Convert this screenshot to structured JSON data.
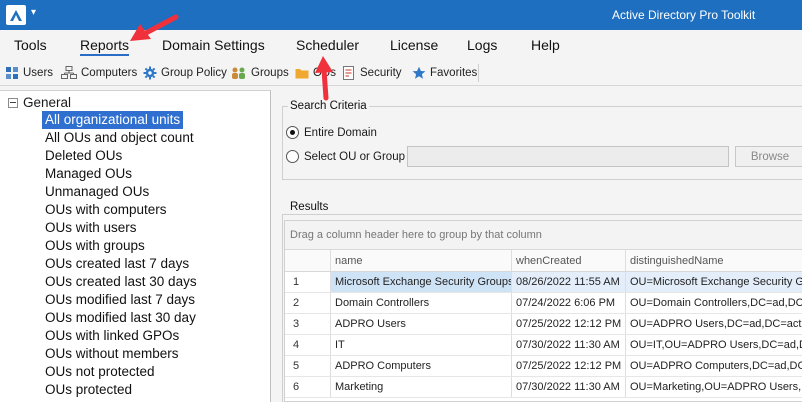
{
  "window": {
    "title": "Active Directory Pro Toolkit",
    "qa_dropdown": "▾"
  },
  "menu": [
    {
      "label": "Tools"
    },
    {
      "label": "Reports",
      "active": true
    },
    {
      "label": "Domain Settings"
    },
    {
      "label": "Scheduler"
    },
    {
      "label": "License"
    },
    {
      "label": "Logs"
    },
    {
      "label": "Help"
    }
  ],
  "toolbar": [
    {
      "label": "Users",
      "icon": "users-icon"
    },
    {
      "label": "Computers",
      "icon": "computers-icon"
    },
    {
      "label": "Group Policy",
      "icon": "gear-icon"
    },
    {
      "label": "Groups",
      "icon": "groups-icon"
    },
    {
      "label": "OUs",
      "icon": "folder-icon"
    },
    {
      "label": "Security",
      "icon": "security-report-icon"
    },
    {
      "label": "Favorites",
      "icon": "star-icon"
    }
  ],
  "tree": {
    "root": "General",
    "items": [
      "All organizational units",
      "All OUs and object count",
      "Deleted OUs",
      "Managed OUs",
      "Unmanaged OUs",
      "OUs with computers",
      "OUs with users",
      "OUs with groups",
      "OUs created last 7 days",
      "OUs created last 30 days",
      "OUs modified last 7 days",
      "OUs modified last 30 day",
      "OUs with linked GPOs",
      "OUs without members",
      "OUs not protected",
      "OUs protected"
    ],
    "selected_index": 0
  },
  "search": {
    "legend": "Search Criteria",
    "option_domain": "Entire Domain",
    "option_ou": "Select OU or Group",
    "ou_value": "",
    "browse": "Browse"
  },
  "results": {
    "legend": "Results",
    "group_hint": "Drag a column header here to group by that column",
    "columns": [
      "",
      "name",
      "whenCreated",
      "distinguishedName"
    ],
    "rows": [
      [
        "1",
        "Microsoft Exchange Security Groups",
        "08/26/2022 11:55 AM",
        "OU=Microsoft Exchange Security Gr"
      ],
      [
        "2",
        "Domain Controllers",
        "07/24/2022 6:06 PM",
        "OU=Domain Controllers,DC=ad,DC="
      ],
      [
        "3",
        "ADPRO Users",
        "07/25/2022 12:12 PM",
        "OU=ADPRO Users,DC=ad,DC=activ"
      ],
      [
        "4",
        "IT",
        "07/30/2022 11:30 AM",
        "OU=IT,OU=ADPRO Users,DC=ad,DC"
      ],
      [
        "5",
        "ADPRO Computers",
        "07/25/2022 12:12 PM",
        "OU=ADPRO Computers,DC=ad,DC="
      ],
      [
        "6",
        "Marketing",
        "07/30/2022 11:30 AM",
        "OU=Marketing,OU=ADPRO Users,D"
      ]
    ]
  },
  "colors": {
    "titlebar": "#1e6fbf",
    "selection": "#2f6fcf",
    "row_highlight": "#cfe3f7",
    "annotation_arrow": "#f0313c"
  }
}
